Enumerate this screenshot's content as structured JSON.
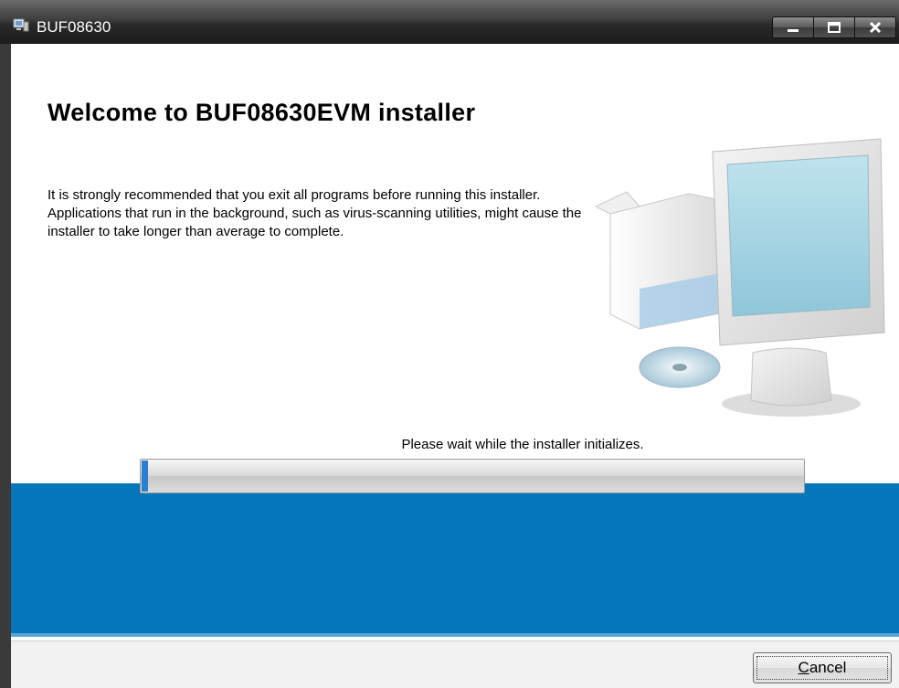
{
  "window": {
    "title": "BUF08630",
    "icon": "installer-computer-icon",
    "controls": {
      "minimize": "minimize-icon",
      "maximize": "maximize-icon",
      "close": "close-icon"
    }
  },
  "installer": {
    "heading": "Welcome to BUF08630EVM installer",
    "description": "It is strongly recommended that you exit all programs before running this installer. Applications that run in the background, such as virus-scanning utilities, might cause the installer to take longer than average to complete.",
    "illustration": "computer-with-box-and-disc-illustration",
    "status": "Please wait while the installer initializes.",
    "progress_fraction": 0.01
  },
  "footer": {
    "cancel_label": "Cancel",
    "cancel_accesskey": "C"
  },
  "colors": {
    "band": "#0576b9",
    "titlebar": "#2a2a2a",
    "progress_fill": "#2a7fd0"
  }
}
